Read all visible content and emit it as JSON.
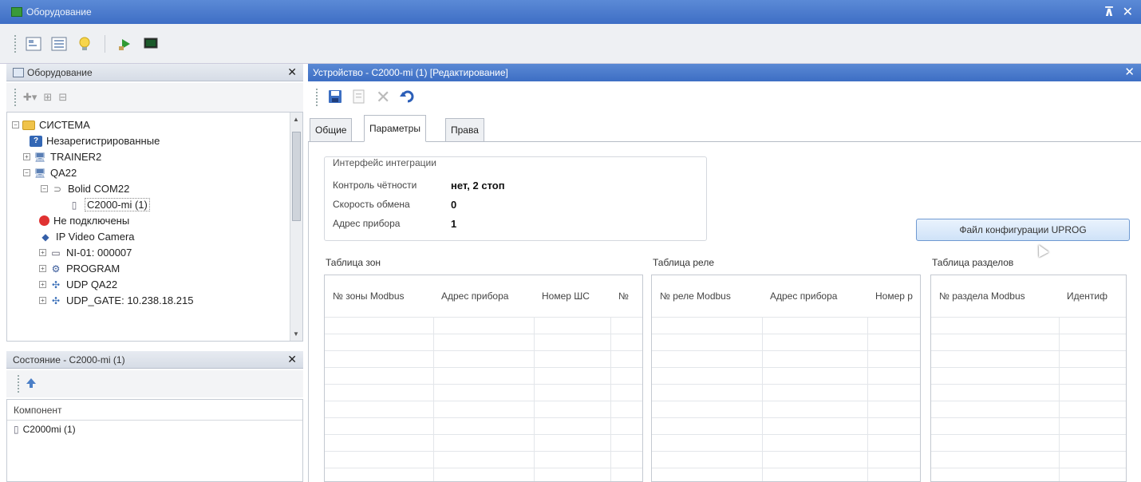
{
  "window": {
    "title": "Оборудование",
    "controls": [
      "⊼",
      "✕"
    ]
  },
  "equipment_panel": {
    "title": "Оборудование",
    "tree": [
      {
        "label": "СИСТЕМА",
        "icon": "folder-icon",
        "toggle": "−"
      },
      {
        "label": "Незарегистрированные",
        "icon": "question-icon"
      },
      {
        "label": "TRAINER2",
        "icon": "computer-icon",
        "toggle": "+"
      },
      {
        "label": "QA22",
        "icon": "computer-icon",
        "toggle": "−"
      },
      {
        "label": "Bolid COM22",
        "icon": "port-icon",
        "toggle": "−"
      },
      {
        "label": "C2000-mi (1)",
        "icon": "device-icon"
      },
      {
        "label": "Не подключены",
        "icon": "disconnected-icon"
      },
      {
        "label": "IP Video Camera",
        "icon": "camera-icon"
      },
      {
        "label": "NI-01: 000007",
        "icon": "module-icon",
        "toggle": "+"
      },
      {
        "label": "PROGRAM",
        "icon": "program-icon",
        "toggle": "+"
      },
      {
        "label": "UDP QA22",
        "icon": "network-icon",
        "toggle": "+"
      },
      {
        "label": "UDP_GATE: 10.238.18.215",
        "icon": "network-icon",
        "toggle": "+"
      }
    ]
  },
  "state_panel": {
    "title": "Состояние - C2000-mi (1)",
    "column": "Компонент",
    "rows": [
      "C2000mi (1)"
    ]
  },
  "device_window": {
    "title": "Устройство - C2000-mi (1) [Редактирование]",
    "tabs": [
      "Общие",
      "Параметры",
      "Права"
    ],
    "active_tab": "Параметры",
    "integration": {
      "group_title": "Интерфейс интеграции",
      "parity_label": "Контроль чётности",
      "parity_value": "нет, 2 стоп",
      "speed_label": "Скорость обмена",
      "speed_value": "0",
      "address_label": "Адрес прибора",
      "address_value": "1"
    },
    "config_button": "Файл конфигурации UPROG",
    "zones": {
      "title": "Таблица зон",
      "columns": [
        "№ зоны Modbus",
        "Адрес прибора",
        "Номер ШС",
        "№"
      ]
    },
    "relays": {
      "title": "Таблица реле",
      "columns": [
        "№ реле Modbus",
        "Адрес прибора",
        "Номер р"
      ]
    },
    "sections": {
      "title": "Таблица разделов",
      "columns": [
        "№ раздела Modbus",
        "Идентиф"
      ]
    }
  }
}
